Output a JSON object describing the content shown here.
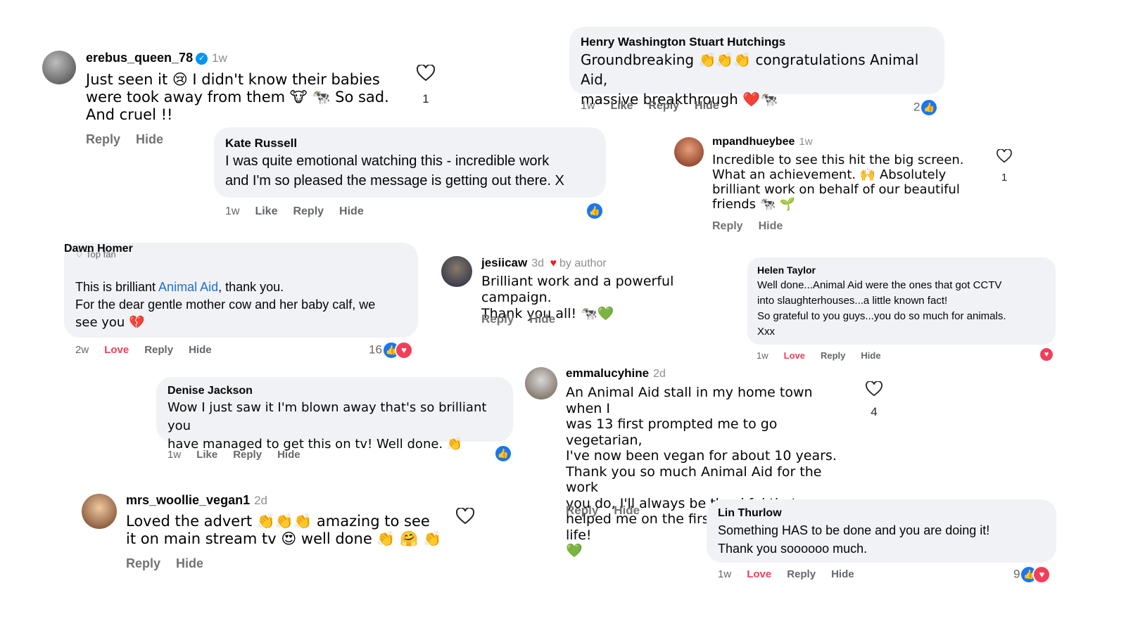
{
  "c1": {
    "username": "erebus_queen_78",
    "time": "1w",
    "lines": [
      "Just seen it 😢 I didn't know their babies",
      "were took away from them 🐮 🐄 So sad.",
      "And cruel !!"
    ],
    "likes": "1",
    "reply": "Reply",
    "hide": "Hide"
  },
  "c2": {
    "name": "Henry Washington Stuart Hutchings",
    "lines": [
      "Groundbreaking 👏👏👏 congratulations Animal Aid,",
      "massive breakthrough ❤️🐄"
    ],
    "time": "1w",
    "like": "Like",
    "reply": "Reply",
    "hide": "Hide",
    "reactions": "2"
  },
  "c3": {
    "name": "Kate Russell",
    "lines": [
      "I was quite emotional watching this - incredible work",
      "and I'm so pleased the message is getting out there. X"
    ],
    "time": "1w",
    "like": "Like",
    "reply": "Reply",
    "hide": "Hide"
  },
  "c4": {
    "username": "mpandhueybee",
    "time": "1w",
    "lines": [
      "Incredible to see this hit the big screen.",
      "What an achievement. 🙌 Absolutely",
      "brilliant work on behalf of our beautiful",
      "friends 🐄 🌱"
    ],
    "likes": "1",
    "reply": "Reply",
    "hide": "Hide"
  },
  "c5": {
    "badge": "Top fan",
    "name": "Dawn Homer",
    "line1_pre": "This is brilliant ",
    "line1_link": "Animal Aid",
    "line1_post": ", thank you.",
    "lines": [
      "For the dear gentle mother cow and her baby calf, we",
      "see you 💔"
    ],
    "time": "2w",
    "love": "Love",
    "reply": "Reply",
    "hide": "Hide",
    "reactions": "16"
  },
  "c6": {
    "username": "jesiicaw",
    "time": "3d",
    "byauthor": "by author",
    "lines": [
      "Brilliant work and a powerful campaign.",
      "Thank you all! 🐄💚"
    ],
    "reply": "Reply",
    "hide": "Hide"
  },
  "c7": {
    "name": "Helen Taylor",
    "lines": [
      "Well done...Animal Aid were the ones that got CCTV",
      "into slaughterhouses...a little known fact!",
      "So grateful to you guys...you do so much for animals.",
      "Xxx"
    ],
    "time": "1w",
    "love": "Love",
    "reply": "Reply",
    "hide": "Hide"
  },
  "c8": {
    "name": "Denise Jackson",
    "lines": [
      "Wow I just saw it I'm blown away that's so brilliant you",
      "have managed to get this on tv! Well done. 👏"
    ],
    "time": "1w",
    "like": "Like",
    "reply": "Reply",
    "hide": "Hide"
  },
  "c9": {
    "username": "emmalucyhine",
    "time": "2d",
    "lines": [
      "An Animal Aid stall in my home town when I",
      "was 13 first prompted me to go vegetarian,",
      "I've now been vegan for about 10 years.",
      "Thank you so much Animal Aid for the work",
      "you do, I'll always be thankful that you",
      "helped me on the first step to a kinder life!",
      "💚"
    ],
    "likes": "4",
    "reply": "Reply",
    "hide": "Hide"
  },
  "c10": {
    "username": "mrs_woollie_vegan1",
    "time": "2d",
    "lines": [
      "Loved the advert 👏👏👏 amazing to see",
      "it on main stream tv 😍 well done 👏 🤗 👏"
    ],
    "reply": "Reply",
    "hide": "Hide"
  },
  "c11": {
    "name": "Lin Thurlow",
    "lines": [
      "Something HAS to be done and you are doing it!",
      "Thank you soooooo much."
    ],
    "time": "1w",
    "love": "Love",
    "reply": "Reply",
    "hide": "Hide",
    "reactions": "9"
  },
  "colors": {
    "like_blue": "#1877f2",
    "love_red": "#f33e58",
    "bubble_bg": "#f0f2f5",
    "link_blue": "#216fdb"
  }
}
